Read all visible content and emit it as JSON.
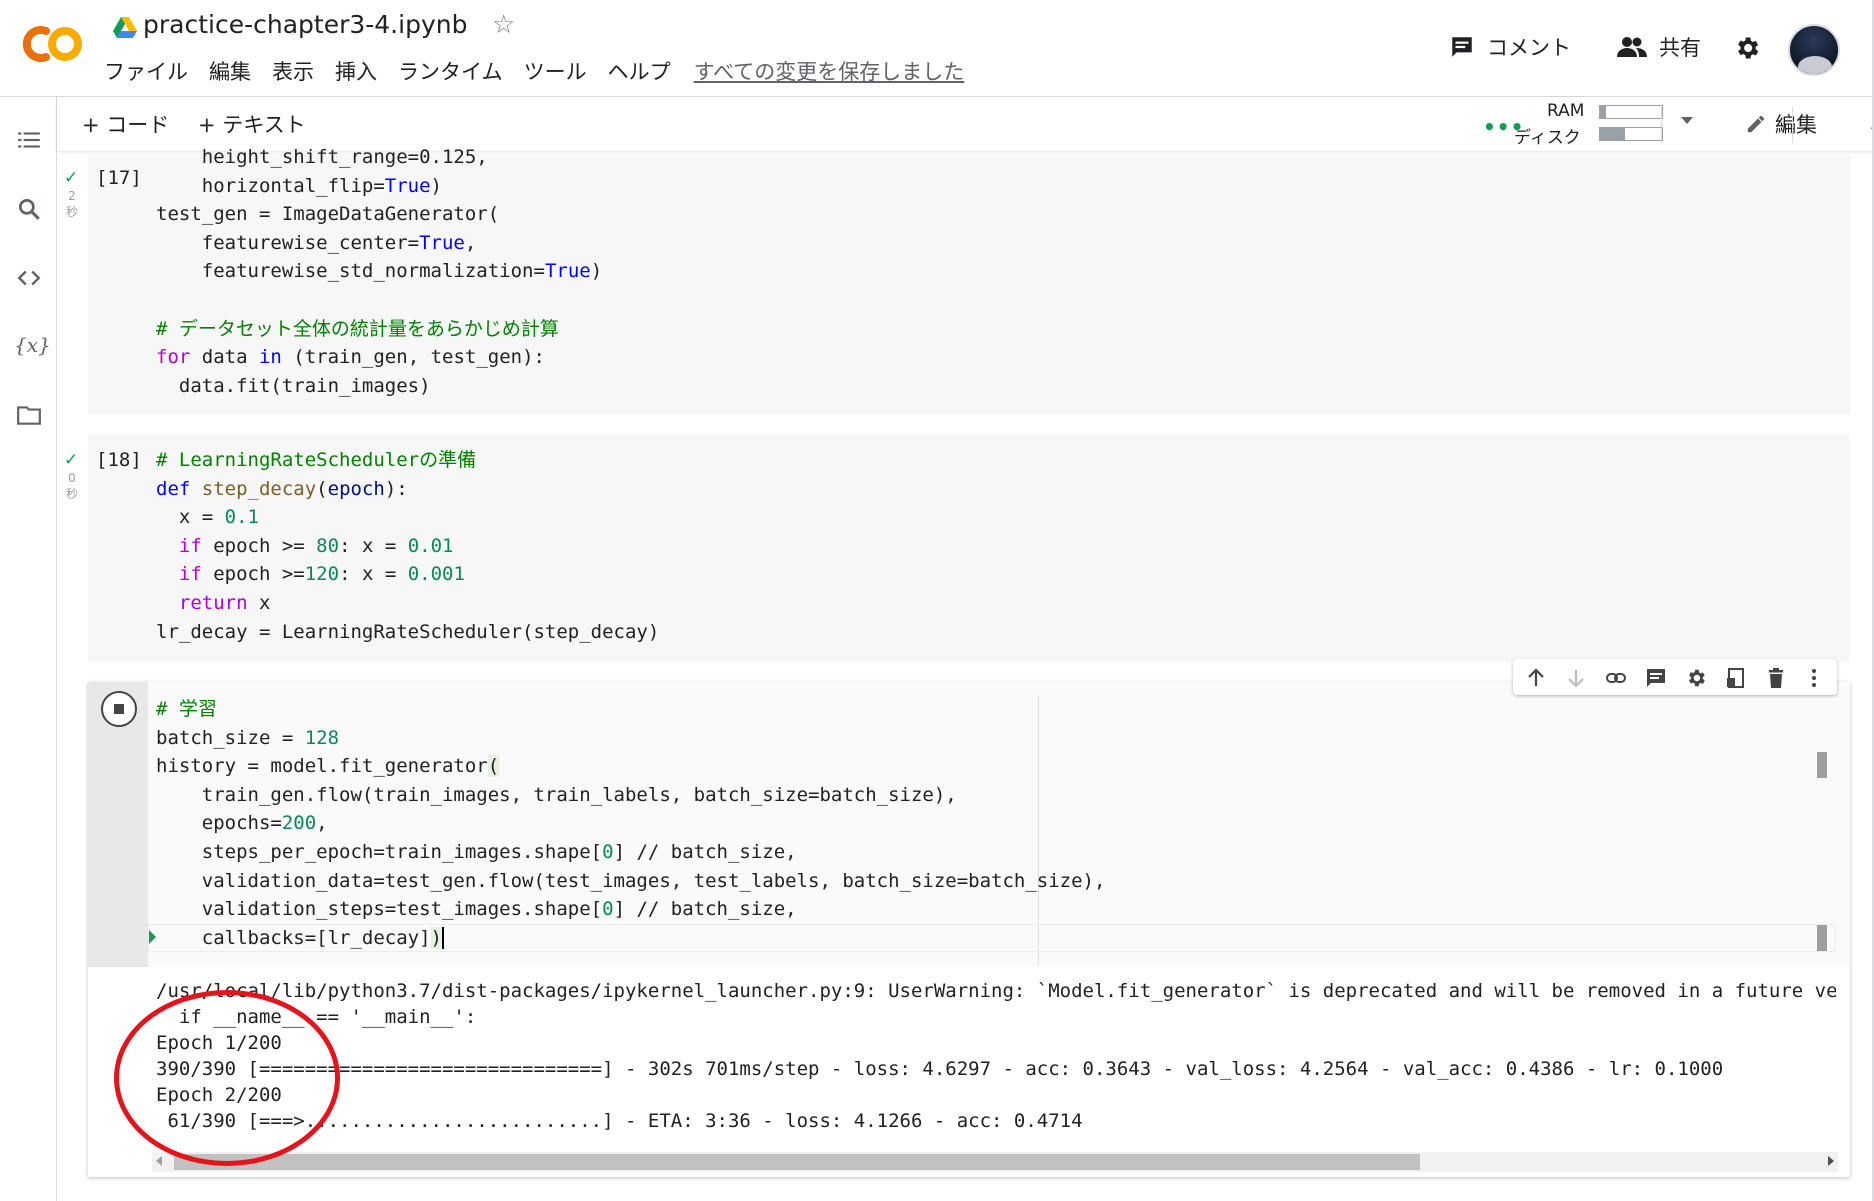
{
  "app": {
    "logo_text": "CO",
    "title": "practice-chapter3-4.ipynb",
    "menu": [
      "ファイル",
      "編集",
      "表示",
      "挿入",
      "ランタイム",
      "ツール",
      "ヘルプ"
    ],
    "saved_status": "すべての変更を保存しました",
    "comment_label": "コメント",
    "share_label": "共有"
  },
  "toolbar": {
    "add_code": "+ コード",
    "add_text": "+ テキスト",
    "ram_label": "RAM",
    "disk_label": "ディスク",
    "ram_usage": 0.1,
    "disk_usage": 0.4,
    "edit_label": "編集",
    "status_dots": "•••"
  },
  "cells": [
    {
      "prompt": "[17]",
      "exec_time": "2\n秒",
      "lines": [
        "    height_shift_range=0.125,",
        "    horizontal_flip=True)",
        "test_gen = ImageDataGenerator(",
        "    featurewise_center=True,",
        "    featurewise_std_normalization=True)",
        "",
        "# データセット全体の統計量をあらかじめ計算",
        "for data in (train_gen, test_gen):",
        "  data.fit(train_images)"
      ]
    },
    {
      "prompt": "[18]",
      "exec_time": "0\n秒",
      "lines": [
        "# LearningRateSchedulerの準備",
        "def step_decay(epoch):",
        "  x = 0.1",
        "  if epoch >= 80: x = 0.01",
        "  if epoch >=120: x = 0.001",
        "  return x",
        "lr_decay = LearningRateScheduler(step_decay)"
      ]
    },
    {
      "prompt": "",
      "lines": [
        "# 学習",
        "batch_size = 128",
        "history = model.fit_generator(",
        "    train_gen.flow(train_images, train_labels, batch_size=batch_size),",
        "    epochs=200,",
        "    steps_per_epoch=train_images.shape[0] // batch_size,",
        "    validation_data=test_gen.flow(test_images, test_labels, batch_size=batch_size),",
        "    validation_steps=test_images.shape[0] // batch_size,",
        "    callbacks=[lr_decay])"
      ],
      "output": [
        "/usr/local/lib/python3.7/dist-packages/ipykernel_launcher.py:9: UserWarning: `Model.fit_generator` is deprecated and will be removed in a future version.",
        "  if __name__ == '__main__':",
        "Epoch 1/200",
        "390/390 [==============================] - 302s 701ms/step - loss: 4.6297 - acc: 0.3643 - val_loss: 4.2564 - val_acc: 0.4386 - lr: 0.1000",
        "Epoch 2/200",
        " 61/390 [===>..........................] - ETA: 3:36 - loss: 4.1266 - acc: 0.4714"
      ]
    }
  ],
  "colors": {
    "accent_green": "#0f9d58",
    "annotation_red": "#e3141b",
    "logo_orange": "#f9ab00",
    "logo_dark_orange": "#e8710a"
  }
}
